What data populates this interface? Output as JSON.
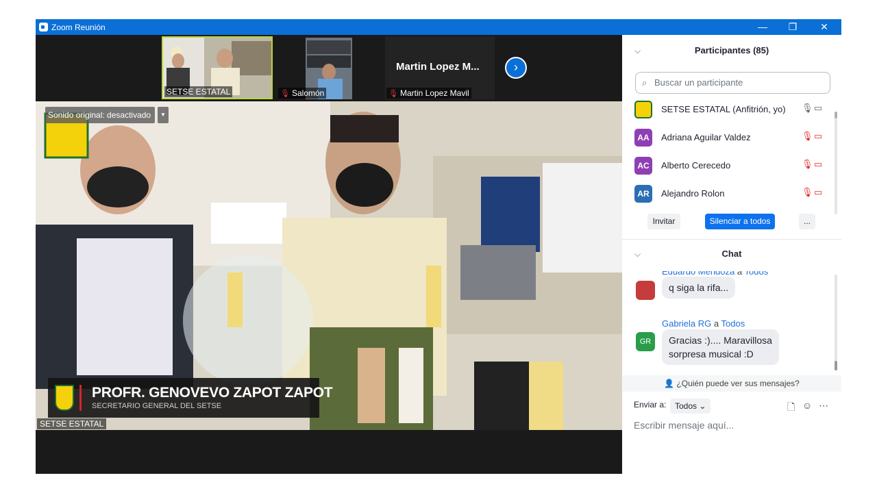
{
  "window": {
    "title": "Zoom Reunión",
    "minimize_glyph": "—",
    "restore_glyph": "❐",
    "close_glyph": "✕"
  },
  "thumbnails": [
    {
      "label": "SETSE ESTATAL",
      "muted": false
    },
    {
      "label": "Salomón",
      "muted": true
    },
    {
      "label": "Martin Lopez Mavil",
      "muted": true,
      "display_name": "Martin Lopez M..."
    }
  ],
  "main_video": {
    "audio_pill": "Sonido original: desactivado",
    "lower_third_name": "PROFR. GENOVEVO ZAPOT ZAPOT",
    "lower_third_role": "SECRETARIO GENERAL DEL SETSE",
    "speaker_label": "SETSE ESTATAL"
  },
  "participants": {
    "header": "Participantes (85)",
    "search_placeholder": "Buscar un participante",
    "list": [
      {
        "name": "SETSE ESTATAL (Anfitrión, yo)",
        "initials": "",
        "color": "#f4d20b",
        "mic_on": true,
        "cam_on": true
      },
      {
        "name": "Adriana Aguilar Valdez",
        "initials": "AA",
        "color": "#8e3fb4",
        "mic_on": false,
        "cam_on": false
      },
      {
        "name": "Alberto Cerecedo",
        "initials": "AC",
        "color": "#8e3fb4",
        "mic_on": false,
        "cam_on": false
      },
      {
        "name": "Alejandro Rolon",
        "initials": "AR",
        "color": "#2a6fb3",
        "mic_on": false,
        "cam_on": false
      }
    ],
    "invite_label": "Invitar",
    "mute_all_label": "Silenciar a todos",
    "more_label": "..."
  },
  "chat": {
    "header": "Chat",
    "messages": [
      {
        "sender": "Eduardo Mendoza",
        "to_word": "a",
        "to": "Todos",
        "text": "q siga la rifa...",
        "initials": "",
        "color": "#c63b3b"
      },
      {
        "sender": "Gabriela RG",
        "to_word": "a",
        "to": "Todos",
        "text": "Gracias :).... Maravillosa\nsorpresa musical :D",
        "initials": "GR",
        "color": "#2a9d4a"
      }
    ],
    "who_sees": "¿Quién puede ver sus mensajes?",
    "send_to_label": "Enviar a:",
    "send_to_value": "Todos",
    "input_placeholder": "Escribir mensaje aquí..."
  },
  "colors": {
    "accent": "#0b6fd6",
    "muted_red": "#e02828"
  }
}
